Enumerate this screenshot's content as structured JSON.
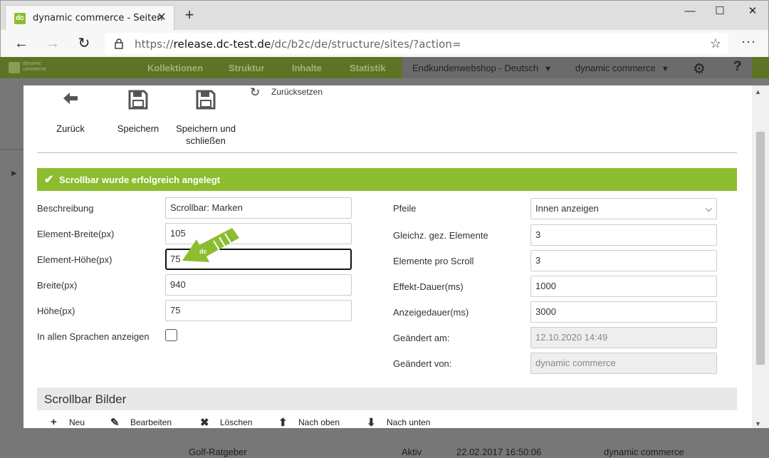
{
  "browser": {
    "tab_title": "dynamic commerce - Seiten",
    "url_scheme": "https://",
    "url_host": "release.dc-test.de",
    "url_path": "/dc/b2c/de/structure/sites/?action="
  },
  "app": {
    "logo_line1": "dynamic",
    "logo_line2": "commerce",
    "menu": [
      "Kollektionen",
      "Struktur",
      "Inhalte",
      "Statistik"
    ],
    "shop_selector": "Endkundenwebshop - Deutsch",
    "company_selector": "dynamic commerce",
    "help": "?",
    "background_rows": [
      {
        "name": "Golf-Ratgeber",
        "status": "Aktiv",
        "date": "22.02.2017 16:50:06",
        "user": "dynamic commerce"
      }
    ]
  },
  "toolbar": {
    "back_label": "Zurück",
    "save_label": "Speichern",
    "save_close_label_1": "Speichern und",
    "save_close_label_2": "schließen",
    "reset_label": "Zurücksetzen"
  },
  "alert": {
    "message": "Scrollbar wurde erfolgreich angelegt",
    "color": "#8cbd2f"
  },
  "form_left": [
    {
      "label": "Beschreibung",
      "value": "Scrollbar: Marken"
    },
    {
      "label": "Element-Breite(px)",
      "value": "105"
    },
    {
      "label": "Element-Höhe(px)",
      "value": "75"
    },
    {
      "label": "Breite(px)",
      "value": "940"
    },
    {
      "label": "Höhe(px)",
      "value": "75"
    }
  ],
  "all_languages_label": "In allen Sprachen anzeigen",
  "all_languages_checked": false,
  "form_right": [
    {
      "label": "Pfeile",
      "value": "Innen anzeigen"
    },
    {
      "label": "Gleichz. gez. Elemente",
      "value": "3"
    },
    {
      "label": "Elemente pro Scroll",
      "value": "3"
    },
    {
      "label": "Effekt-Dauer(ms)",
      "value": "1000"
    },
    {
      "label": "Anzeigedauer(ms)",
      "value": "3000"
    },
    {
      "label": "Geändert am:",
      "value": "12.10.2020 14:49"
    },
    {
      "label": "Geändert von:",
      "value": "dynamic commerce"
    }
  ],
  "images_section": {
    "title": "Scrollbar Bilder",
    "actions": [
      {
        "label": "Neu",
        "icon": "plus-icon"
      },
      {
        "label": "Bearbeiten",
        "icon": "pencil-icon"
      },
      {
        "label": "Löschen",
        "icon": "x-icon"
      },
      {
        "label": "Nach oben",
        "icon": "arrow-up-icon"
      },
      {
        "label": "Nach unten",
        "icon": "arrow-down-icon"
      }
    ]
  },
  "colors": {
    "brand_green": "#8cbd2f",
    "overlay_nav": "#5d7326"
  }
}
